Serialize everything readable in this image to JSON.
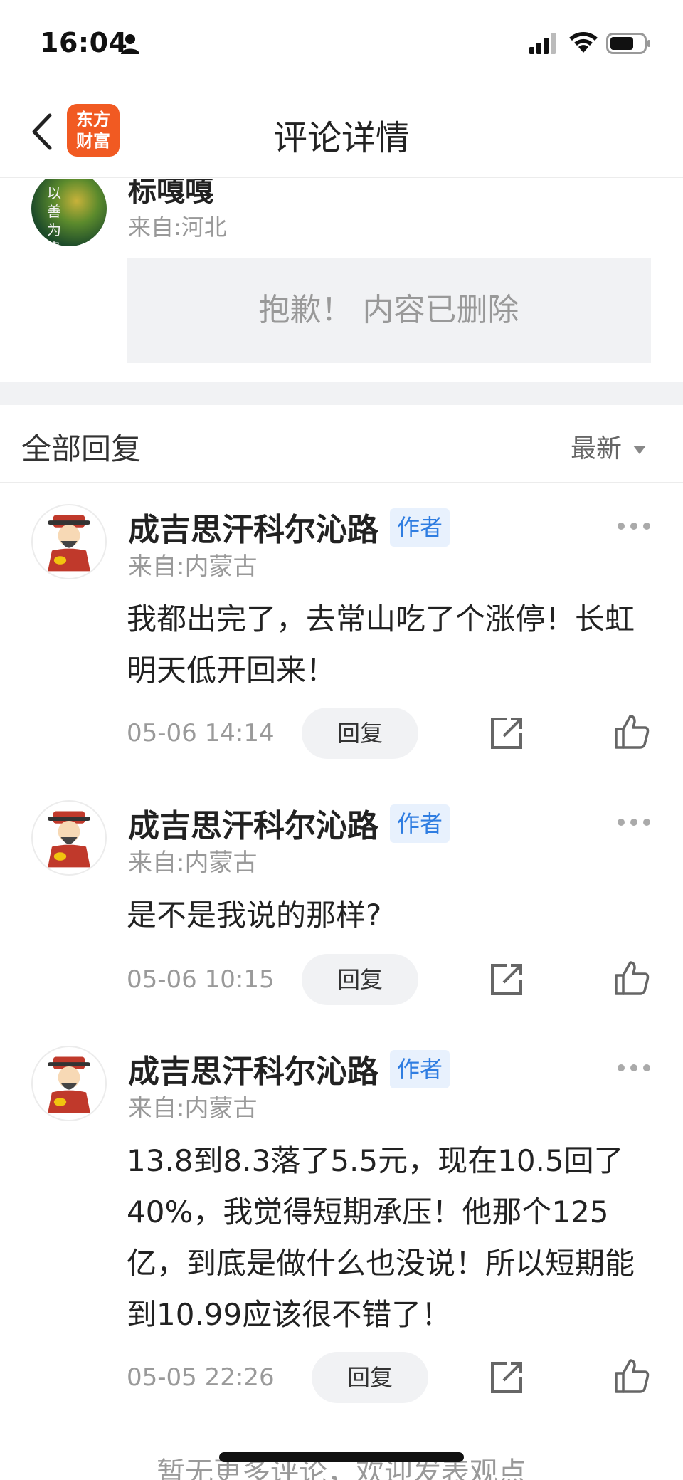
{
  "status": {
    "time": "16:04"
  },
  "nav": {
    "title": "评论详情",
    "logo_line1": "东方",
    "logo_line2": "财富"
  },
  "post": {
    "avatar_text": "以善为贵",
    "username": "标嘎嘎",
    "location": "来自:河北",
    "deleted_message": "抱歉！ 内容已删除"
  },
  "replies": {
    "title": "全部回复",
    "sort_label": "最新",
    "items": [
      {
        "username": "成吉思汗科尔沁路",
        "badge": "作者",
        "location": "来自:内蒙古",
        "text": "我都出完了，去常山吃了个涨停！长虹明天低开回来！",
        "time": "05-06 14:14",
        "reply_label": "回复"
      },
      {
        "username": "成吉思汗科尔沁路",
        "badge": "作者",
        "location": "来自:内蒙古",
        "text": "是不是我说的那样?",
        "time": "05-06 10:15",
        "reply_label": "回复"
      },
      {
        "username": "成吉思汗科尔沁路",
        "badge": "作者",
        "location": "来自:内蒙古",
        "text": "13.8到8.3落了5.5元，现在10.5回了40%，我觉得短期承压！他那个125亿，到底是做什么也没说！所以短期能到10.99应该很不错了！",
        "time": "05-05 22:26",
        "reply_label": "回复"
      }
    ]
  },
  "footer": {
    "text": "暂无更多评论，欢迎发表观点"
  },
  "colors": {
    "brand": "#f15a22",
    "badge_text": "#2f7de1",
    "badge_bg": "#e8f1fd"
  },
  "icons": [
    "back-arrow-icon",
    "person-icon",
    "signal-icon",
    "wifi-icon",
    "battery-icon",
    "more-icon",
    "share-icon",
    "thumbs-up-icon"
  ]
}
